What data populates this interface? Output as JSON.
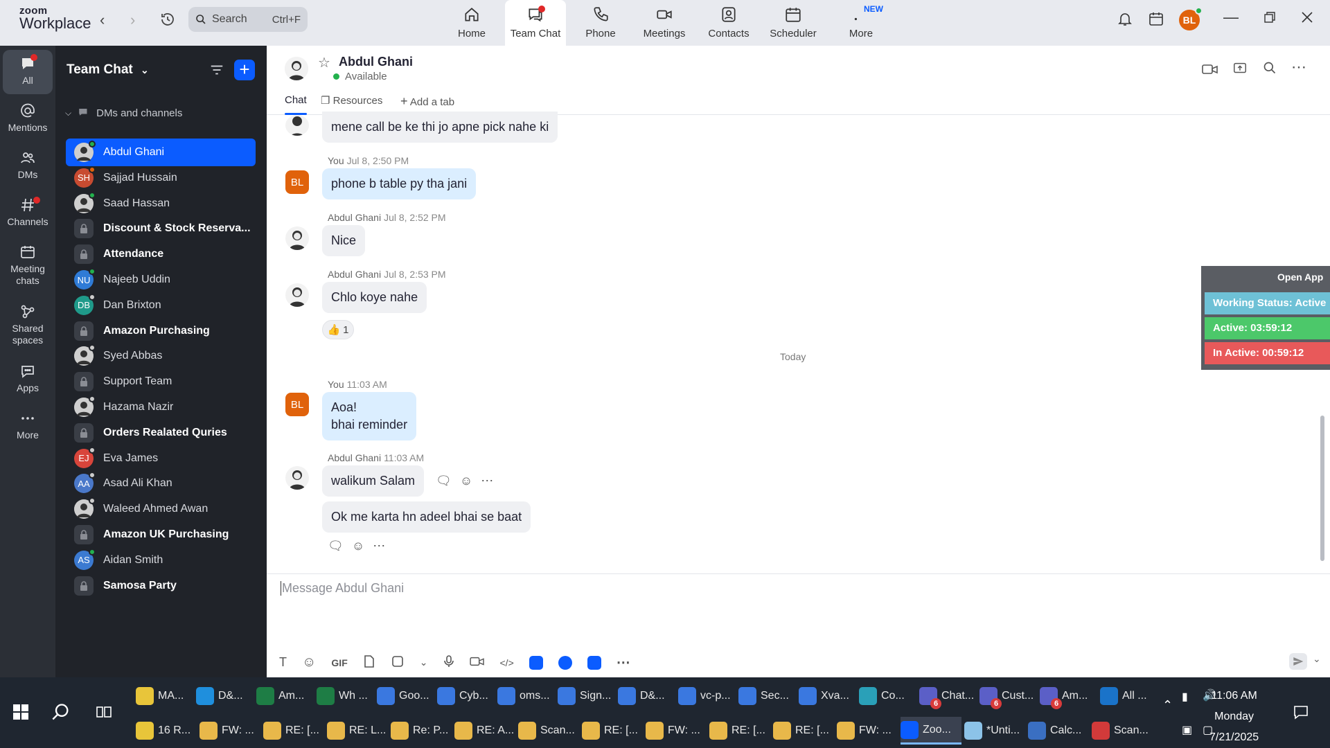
{
  "app": {
    "logo_line1": "zoom",
    "logo_line2": "Workplace",
    "search_label": "Search",
    "search_shortcut": "Ctrl+F",
    "nav_tabs": [
      {
        "label": "Home",
        "icon": "home-icon"
      },
      {
        "label": "Team Chat",
        "icon": "chat-icon",
        "active": true
      },
      {
        "label": "Phone",
        "icon": "phone-icon"
      },
      {
        "label": "Meetings",
        "icon": "video-icon"
      },
      {
        "label": "Contacts",
        "icon": "contacts-icon"
      },
      {
        "label": "Scheduler",
        "icon": "calendar-icon"
      },
      {
        "label": "More",
        "icon": "more-icon"
      }
    ],
    "new_badge": "NEW",
    "user_initials": "BL",
    "accent_color": "#0b5cff"
  },
  "rail": {
    "items": [
      {
        "label": "All"
      },
      {
        "label": "Mentions"
      },
      {
        "label": "DMs"
      },
      {
        "label": "Channels"
      },
      {
        "label": "Meeting chats"
      },
      {
        "label": "Shared spaces"
      },
      {
        "label": "Apps"
      },
      {
        "label": "More"
      }
    ]
  },
  "sidebar": {
    "title": "Team Chat",
    "section": "DMs and channels",
    "items": [
      {
        "label": "Abdul Ghani",
        "type": "photo",
        "active": true
      },
      {
        "label": "Sajjad Hussain",
        "type": "initials",
        "initials": "SH",
        "color": "#c84b31"
      },
      {
        "label": "Saad Hassan",
        "type": "photo"
      },
      {
        "label": "Discount & Stock Reserva...",
        "type": "channel",
        "bold": true
      },
      {
        "label": "Attendance",
        "type": "channel",
        "bold": true
      },
      {
        "label": "Najeeb Uddin",
        "type": "initials",
        "initials": "NU",
        "color": "#2f7bd6"
      },
      {
        "label": "Dan Brixton",
        "type": "initials",
        "initials": "DB",
        "color": "#1f9a8a"
      },
      {
        "label": "Amazon Purchasing",
        "type": "channel",
        "bold": true
      },
      {
        "label": "Syed Abbas",
        "type": "photo"
      },
      {
        "label": "Support Team",
        "type": "channel"
      },
      {
        "label": "Hazama Nazir",
        "type": "photo"
      },
      {
        "label": "Orders Realated Quries",
        "type": "channel",
        "bold": true
      },
      {
        "label": "Eva James",
        "type": "initials",
        "initials": "EJ",
        "color": "#d8453b"
      },
      {
        "label": "Asad Ali Khan",
        "type": "initials",
        "initials": "AA",
        "color": "#4a78c9"
      },
      {
        "label": "Waleed Ahmed Awan",
        "type": "photo"
      },
      {
        "label": "Amazon UK Purchasing",
        "type": "channel",
        "bold": true
      },
      {
        "label": "Aidan Smith",
        "type": "initials",
        "initials": "AS",
        "color": "#3b7ad1"
      },
      {
        "label": "Samosa Party",
        "type": "channel",
        "bold": true
      }
    ]
  },
  "chat": {
    "contact_name": "Abdul Ghani",
    "contact_status": "Available",
    "tabs": [
      "Chat",
      "Resources",
      "Add a tab"
    ],
    "messages": [
      {
        "text": "mene call be ke thi jo apne pick nahe ki"
      },
      {
        "sender": "You",
        "time": "Jul 8, 2:50 PM",
        "text": "phone b table py tha jani"
      },
      {
        "sender": "Abdul Ghani",
        "time": "Jul 8, 2:52 PM",
        "text": "Nice"
      },
      {
        "sender": "Abdul Ghani",
        "time": "Jul 8, 2:53 PM",
        "text": "Chlo koye nahe"
      },
      {
        "sender": "You",
        "time": "11:03 AM",
        "line1": "Aoa!",
        "line2": "bhai reminder"
      },
      {
        "sender": "Abdul Ghani",
        "time": "11:03 AM",
        "text": "walikum Salam"
      },
      {
        "text": "Ok me karta hn adeel bhai se baat"
      }
    ],
    "reaction": {
      "emoji": "👍",
      "count": "1"
    },
    "day_separator": "Today",
    "composer_placeholder": "Message Abdul Ghani",
    "gif_label": "GIF"
  },
  "widget": {
    "open_label": "Open App",
    "working_status": "Working Status: Active",
    "active": "Active: 03:59:12",
    "inactive": "In Active: 00:59:12",
    "colors": {
      "working": "#6ec1d6",
      "active": "#4cc86a",
      "inactive": "#e8595a"
    }
  },
  "taskbar": {
    "row1": [
      {
        "label": "MA...",
        "color": "#e8c53a"
      },
      {
        "label": "D&...",
        "color": "#1f8fdd"
      },
      {
        "label": "Am...",
        "color": "#1e7d45"
      },
      {
        "label": "Wh ...",
        "color": "#1e7d45"
      },
      {
        "label": "Goo...",
        "color": "#3a78e0"
      },
      {
        "label": "Cyb...",
        "color": "#3a78e0"
      },
      {
        "label": "oms...",
        "color": "#3a78e0"
      },
      {
        "label": "Sign...",
        "color": "#3a78e0"
      },
      {
        "label": "D&...",
        "color": "#3a78e0"
      },
      {
        "label": "vc-p...",
        "color": "#3a78e0"
      },
      {
        "label": "Sec...",
        "color": "#3a78e0"
      },
      {
        "label": "Xva...",
        "color": "#3a78e0"
      },
      {
        "label": "Co...",
        "color": "#2aa0b8"
      },
      {
        "label": "Chat...",
        "color": "#5b5fc7",
        "badge": "6"
      },
      {
        "label": "Cust...",
        "color": "#5b5fc7",
        "badge": "6"
      },
      {
        "label": "Am...",
        "color": "#5b5fc7",
        "badge": "6"
      },
      {
        "label": "All ...",
        "color": "#1a73c9"
      }
    ],
    "row2": [
      {
        "label": "16 R...",
        "color": "#e8c53a"
      },
      {
        "label": "FW: ...",
        "color": "#e8b84a"
      },
      {
        "label": "RE: [...",
        "color": "#e8b84a"
      },
      {
        "label": "RE: L...",
        "color": "#e8b84a"
      },
      {
        "label": "Re: P...",
        "color": "#e8b84a"
      },
      {
        "label": "RE: A...",
        "color": "#e8b84a"
      },
      {
        "label": "Scan...",
        "color": "#e8b84a"
      },
      {
        "label": "RE: [...",
        "color": "#e8b84a"
      },
      {
        "label": "FW: ...",
        "color": "#e8b84a"
      },
      {
        "label": "RE: [...",
        "color": "#e8b84a"
      },
      {
        "label": "RE: [...",
        "color": "#e8b84a"
      },
      {
        "label": "FW: ...",
        "color": "#e8b84a"
      },
      {
        "label": "Zoo...",
        "color": "#0b5cff",
        "active": true
      },
      {
        "label": "*Unti...",
        "color": "#8cc3e8"
      },
      {
        "label": "Calc...",
        "color": "#3a6fc2"
      },
      {
        "label": "Scan...",
        "color": "#d23a3a"
      }
    ],
    "time": "11:06 AM",
    "day": "Monday",
    "date": "7/21/2025"
  }
}
